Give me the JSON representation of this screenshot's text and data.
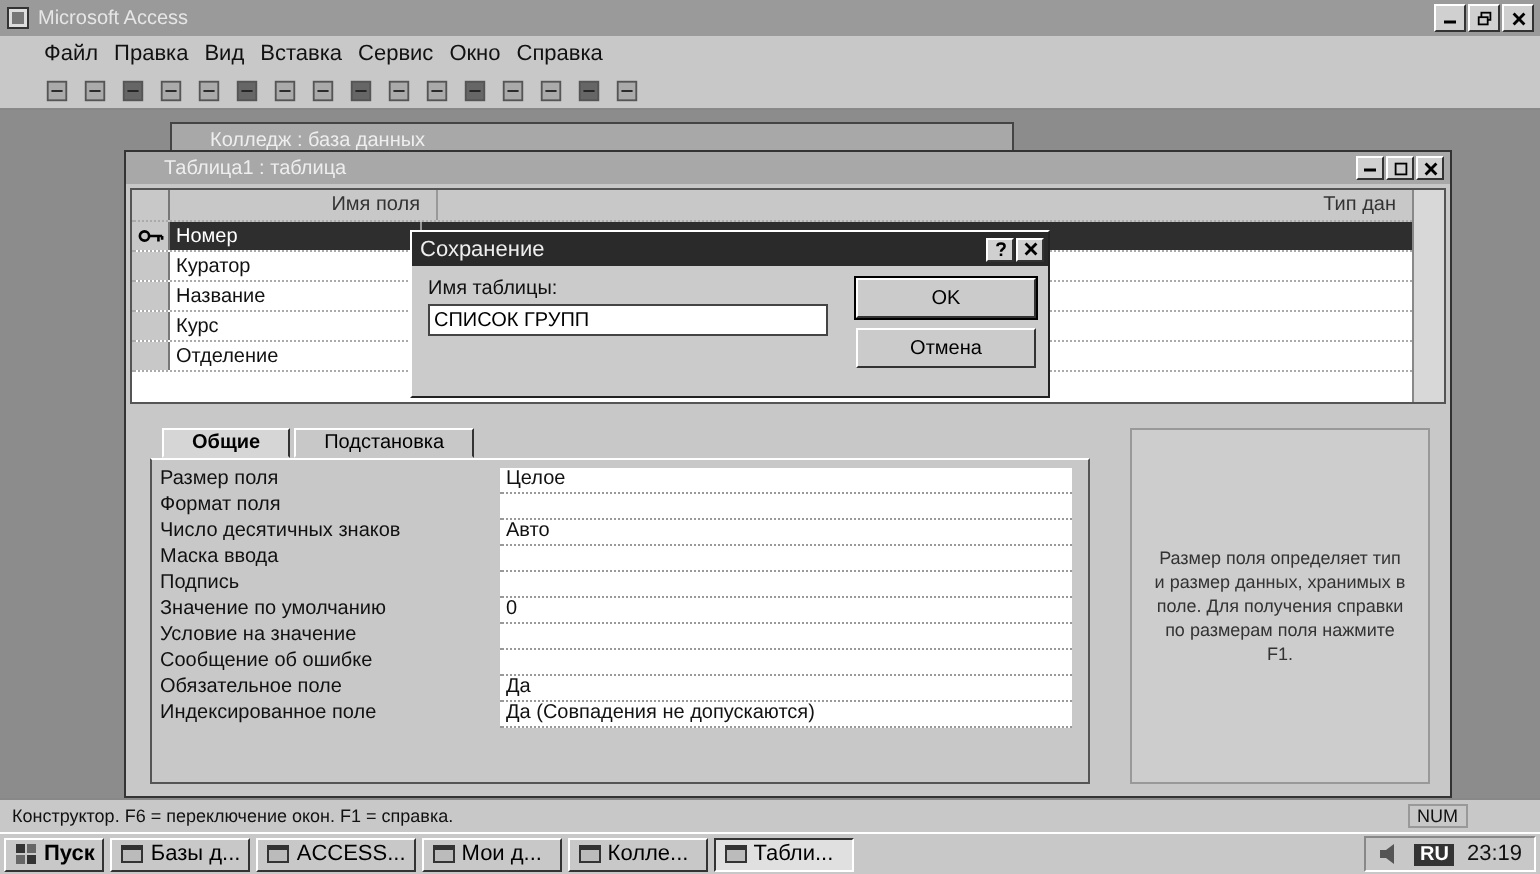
{
  "app": {
    "title": "Microsoft Access",
    "menu": [
      "Файл",
      "Правка",
      "Вид",
      "Вставка",
      "Сервис",
      "Окно",
      "Справка"
    ]
  },
  "db_window": {
    "title": "Колледж : база данных"
  },
  "table_window": {
    "title": "Таблица1 : таблица",
    "columns": [
      "Имя поля",
      "Тип дан"
    ],
    "rows": [
      {
        "name": "Номер",
        "selected": true,
        "key": true
      },
      {
        "name": "Куратор",
        "selected": false,
        "key": false
      },
      {
        "name": "Название",
        "selected": false,
        "key": false
      },
      {
        "name": "Курс",
        "selected": false,
        "key": false
      },
      {
        "name": "Отделение",
        "selected": false,
        "key": false
      }
    ],
    "property_tabs": [
      {
        "label": "Общие",
        "selected": true
      },
      {
        "label": "Подстановка",
        "selected": false
      }
    ],
    "properties": [
      {
        "label": "Размер поля",
        "value": "Целое"
      },
      {
        "label": "Формат поля"
      },
      {
        "label": "Число десятичных знаков",
        "value": "Авто"
      },
      {
        "label": "Маска ввода"
      },
      {
        "label": "Подпись"
      },
      {
        "label": "Значение по умолчанию",
        "value": "0"
      },
      {
        "label": "Условие на значение"
      },
      {
        "label": "Сообщение об ошибке"
      },
      {
        "label": "Обязательное поле",
        "value": "Да"
      },
      {
        "label": "Индексированное поле",
        "value": "Да (Совпадения не допускаются)"
      }
    ],
    "help": "Размер поля определяет тип и размер данных, хранимых в поле. Для получения справки по размерам поля нажмите F1."
  },
  "dialog": {
    "title": "Сохранение",
    "label": "Имя таблицы:",
    "value": "СПИСОК ГРУПП",
    "buttons": [
      "OK",
      "Отмена"
    ]
  },
  "status_bar": {
    "text": "Конструктор. F6 = переключение окон. F1 = справка.",
    "indicator": "NUM"
  },
  "taskbar": {
    "start": "Пуск",
    "items": [
      {
        "label": "Базы д...",
        "selected": false
      },
      {
        "label": "ACCESS...",
        "selected": false
      },
      {
        "label": "Мои д...",
        "selected": false
      },
      {
        "label": "Колле...",
        "selected": false
      },
      {
        "label": "Табли...",
        "selected": true
      }
    ],
    "lang": "RU",
    "clock": "23:19"
  }
}
